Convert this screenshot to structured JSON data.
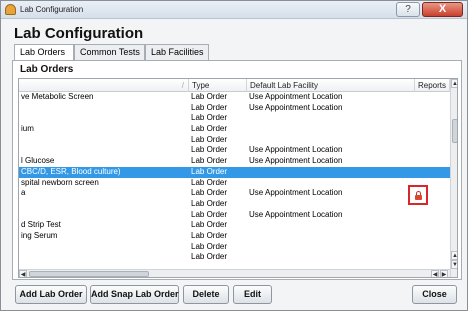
{
  "window": {
    "title": "Lab Configuration",
    "help_label": "?",
    "close_label": "X"
  },
  "heading": "Lab Configuration",
  "tabs": [
    {
      "label": "Lab Orders",
      "active": true
    },
    {
      "label": "Common Tests",
      "active": false
    },
    {
      "label": "Lab Facilities",
      "active": false
    }
  ],
  "panel_title": "Lab Orders",
  "table": {
    "columns": [
      {
        "label": ""
      },
      {
        "label": "Type"
      },
      {
        "label": "Default Lab Facility"
      },
      {
        "label": "Reports"
      }
    ],
    "sort_indicator": "/",
    "rows": [
      {
        "name": "ve Metabolic Screen",
        "type": "Lab Order",
        "facility": "Use Appointment Location",
        "reports": ""
      },
      {
        "name": "",
        "type": "Lab Order",
        "facility": "Use Appointment Location",
        "reports": ""
      },
      {
        "name": "",
        "type": "Lab Order",
        "facility": "",
        "reports": ""
      },
      {
        "name": "ium",
        "type": "Lab Order",
        "facility": "",
        "reports": ""
      },
      {
        "name": "",
        "type": "Lab Order",
        "facility": "",
        "reports": ""
      },
      {
        "name": "",
        "type": "Lab Order",
        "facility": "Use Appointment Location",
        "reports": ""
      },
      {
        "name": "l Glucose",
        "type": "Lab Order",
        "facility": "Use Appointment Location",
        "reports": ""
      },
      {
        "name": "CBC/D, ESR, Blood culture)",
        "type": "Lab Order",
        "facility": "",
        "reports": "",
        "selected": true
      },
      {
        "name": "spital newborn screen",
        "type": "Lab Order",
        "facility": "",
        "reports": ""
      },
      {
        "name": "a",
        "type": "Lab Order",
        "facility": "Use Appointment Location",
        "reports": ""
      },
      {
        "name": "",
        "type": "Lab Order",
        "facility": "",
        "reports": ""
      },
      {
        "name": "",
        "type": "Lab Order",
        "facility": "Use Appointment Location",
        "reports": ""
      },
      {
        "name": "d Strip Test",
        "type": "Lab Order",
        "facility": "",
        "reports": ""
      },
      {
        "name": "ing Serum",
        "type": "Lab Order",
        "facility": "",
        "reports": ""
      },
      {
        "name": "",
        "type": "Lab Order",
        "facility": "",
        "reports": ""
      },
      {
        "name": "",
        "type": "Lab Order",
        "facility": "",
        "reports": ""
      }
    ]
  },
  "report_icon": "lock-icon",
  "scroll_arrows": {
    "up": "▲",
    "down": "▼",
    "left": "◀",
    "right": "▶"
  },
  "buttons": {
    "add_lab_order": "Add Lab Order",
    "add_snap_lab_order": "Add Snap Lab Order",
    "delete": "Delete",
    "edit": "Edit",
    "close": "Close"
  },
  "colors": {
    "selection": "#3399e6",
    "highlight_box": "#d8262a",
    "lock": "#d9472f"
  }
}
